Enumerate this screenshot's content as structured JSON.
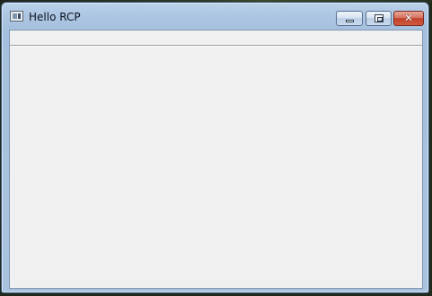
{
  "window": {
    "title": "Hello RCP",
    "controls": {
      "minimize": "minimize",
      "maximize": "maximize",
      "close": "✕"
    }
  },
  "icons": {
    "app": "app-window-icon",
    "minimize": "minimize-icon",
    "maximize": "maximize-icon",
    "close": "close-icon"
  },
  "colors": {
    "client_background": "#f0f0f0",
    "frame": "#a9c3df",
    "close_button": "#c2412b"
  }
}
